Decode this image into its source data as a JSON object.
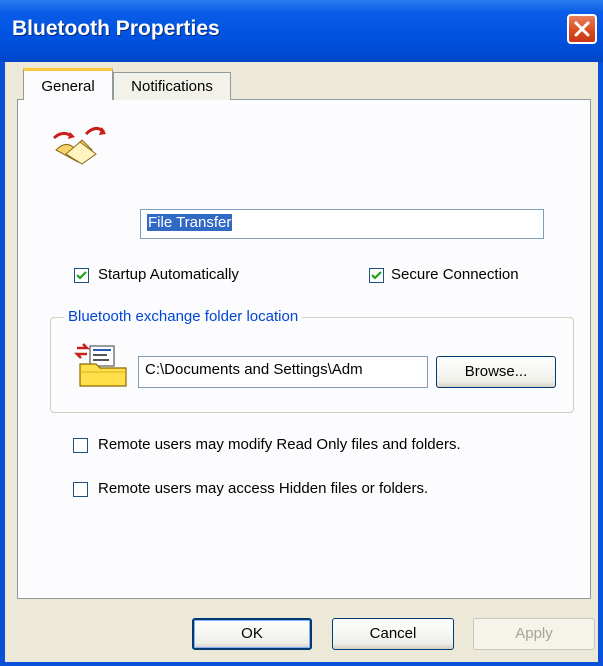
{
  "window": {
    "title": "Bluetooth Properties"
  },
  "tabs": [
    {
      "label": "General",
      "active": true
    },
    {
      "label": "Notifications",
      "active": false
    }
  ],
  "general": {
    "service_name": "File Transfer",
    "startup_auto": {
      "label": "Startup Automatically",
      "checked": true
    },
    "secure_conn": {
      "label": "Secure Connection",
      "checked": true
    },
    "folder_group": {
      "legend": "Bluetooth exchange folder location",
      "path": "C:\\Documents and Settings\\Adm",
      "browse_label": "Browse..."
    },
    "modify_readonly": {
      "label": "Remote users may modify Read Only files and folders.",
      "checked": false
    },
    "access_hidden": {
      "label": "Remote users may access Hidden files or folders.",
      "checked": false
    }
  },
  "buttons": {
    "ok": "OK",
    "cancel": "Cancel",
    "apply": "Apply"
  },
  "colors": {
    "titlebar": "#0054e3",
    "dialog_bg": "#ece9d8",
    "legend_text": "#0046d5",
    "close_button": "#d9481c"
  },
  "icons": [
    "close-icon",
    "file-transfer-icon",
    "folder-exchange-icon",
    "checkmark-icon"
  ]
}
